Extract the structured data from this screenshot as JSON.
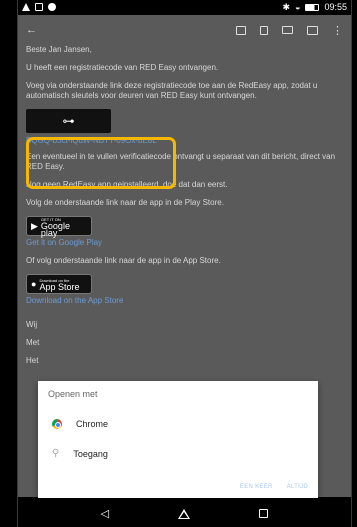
{
  "status_bar": {
    "time": "09:55",
    "icons": [
      "warning-icon",
      "image-icon",
      "app-circle-icon",
      "bluetooth-icon",
      "wifi-icon",
      "battery-icon"
    ]
  },
  "toolbar": {
    "back_glyph": "←",
    "icons": [
      "archive-icon",
      "delete-icon",
      "mail-icon",
      "label-icon",
      "more-icon"
    ]
  },
  "email": {
    "greeting": "Beste Jan Jansen,",
    "line1": "U heeft een registratiecode van RED Easy ontvangen.",
    "line2": "Voeg via onderstaande link deze registratiecode toe aan de RedEasy app, zodat u automatisch sleutels voor deuren van RED Easy kunt ontvangen.",
    "registration_code": "BQGQ-b3ct-lQdW-NBTY-09Ox-bE8L",
    "line3": "Een eventueel in te vullen verificatiecode ontvangt u separaat van dit bericht, direct van RED Easy.",
    "line4": "Nog geen RedEasy app geinstalleerd, doe dat dan eerst.",
    "line5": "Volg de onderstaande link naar de app in de Play Store.",
    "google_play": {
      "small": "GET IT ON",
      "big": "Google play"
    },
    "google_link": "Get it on Google Play",
    "line6": "Of volg onderstaande link naar de app in de App Store.",
    "app_store": {
      "small": "Download on the",
      "big": "App Store"
    },
    "apple_link": "Download on the App Store",
    "cut1": "Wij",
    "cut2": "Met",
    "cut3": "Het"
  },
  "dialog": {
    "title": "Openen met",
    "options": [
      {
        "label": "Chrome",
        "icon": "chrome-icon"
      },
      {
        "label": "Toegang",
        "icon": "key-icon"
      }
    ],
    "once": "EEN KEER",
    "always": "ALTIJD"
  },
  "colors": {
    "highlight": "#f5b800",
    "link": "#6e9bd4",
    "screen_dim": "#5a5a5a"
  }
}
